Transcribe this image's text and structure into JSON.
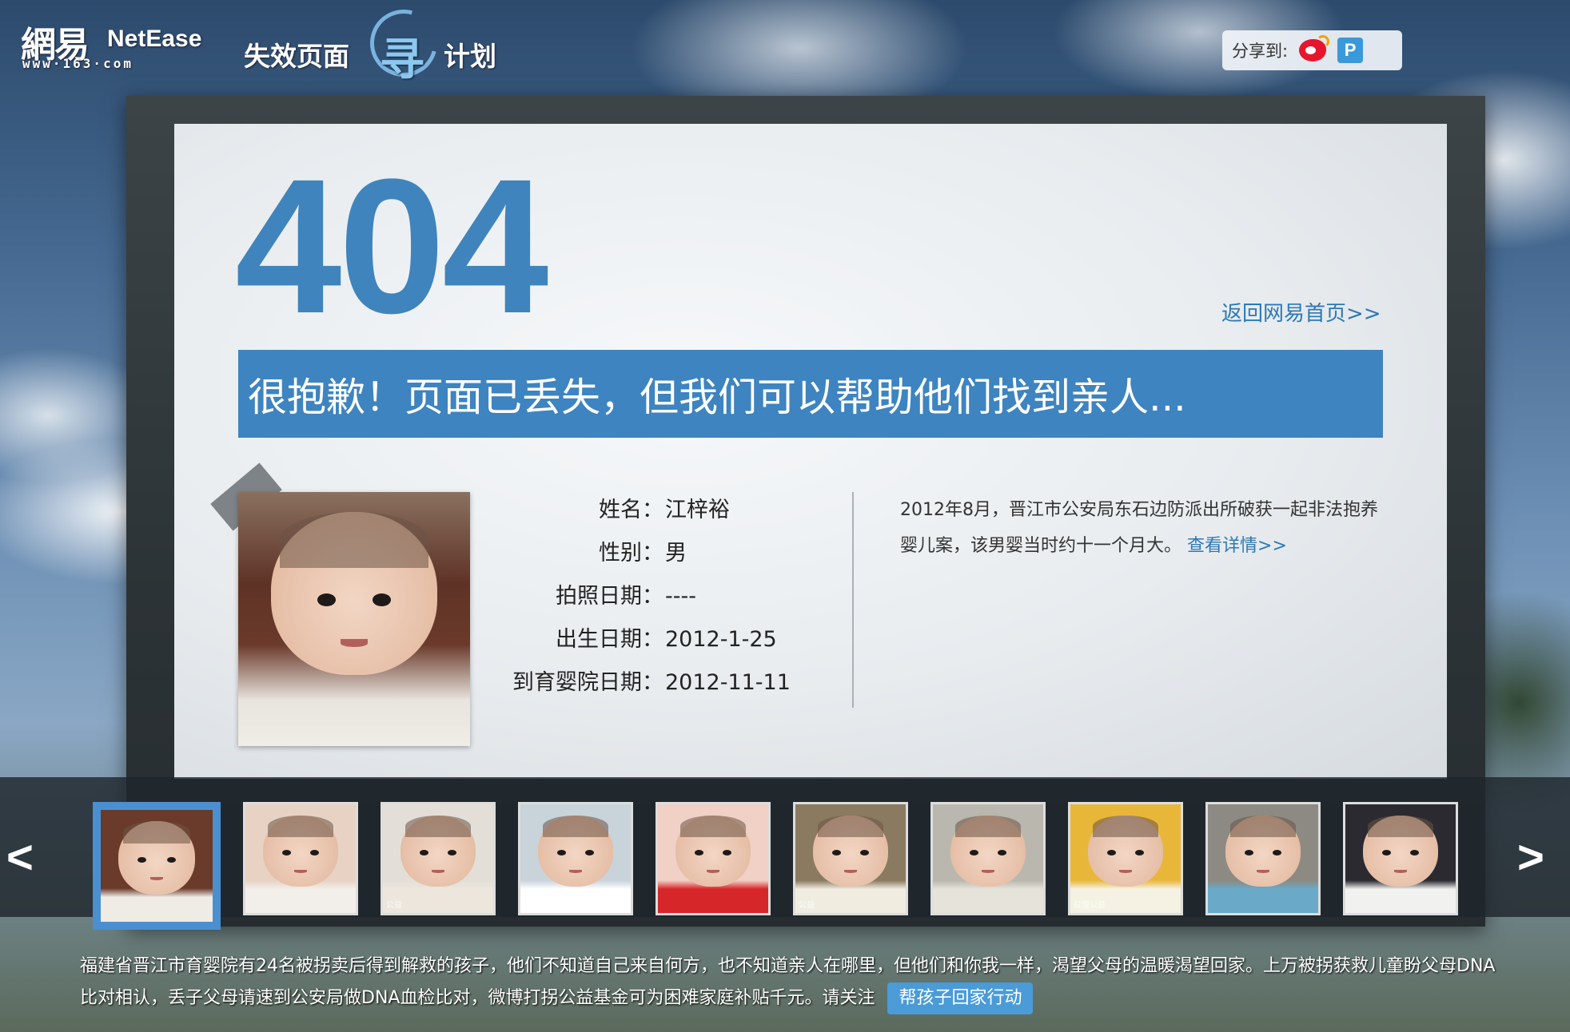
{
  "header": {
    "logo_cn": "網易",
    "logo_en": "NetEase",
    "logo_url": "www·163·com",
    "campaign_pre": "失效页面",
    "campaign_mark": "寻",
    "campaign_post": "计划",
    "share_label": "分享到:",
    "share_icons": [
      "weibo-icon",
      "qq-weibo-icon"
    ]
  },
  "error": {
    "code": "404",
    "home_link": "返回网易首页>>",
    "banner": "很抱歉！页面已丢失，但我们可以帮助他们找到亲人..."
  },
  "child": {
    "fields": [
      {
        "label": "姓名：",
        "value": "江梓裕"
      },
      {
        "label": "性别：",
        "value": "男"
      },
      {
        "label": "拍照日期：",
        "value": "----"
      },
      {
        "label": "出生日期：",
        "value": "2012-1-25"
      },
      {
        "label": "到育婴院日期：",
        "value": "2012-11-11"
      }
    ],
    "story": "2012年8月，晋江市公安局东石边防派出所破获一起非法抱养婴儿案，该男婴当时约十一个月大。",
    "details_link": "查看详情>>"
  },
  "carousel": {
    "prev": "<",
    "next": ">",
    "thumbs": [
      {
        "stamp": "",
        "bg": "#6a3a2a",
        "shirt": "#efebe5"
      },
      {
        "stamp": "",
        "bg": "#e7d2c4",
        "shirt": "#f2eeea"
      },
      {
        "stamp": "公益",
        "bg": "#e3dfd8",
        "shirt": "#ece6dc"
      },
      {
        "stamp": "",
        "bg": "#c9d3da",
        "shirt": "#ffffff"
      },
      {
        "stamp": "",
        "bg": "#f1d0c6",
        "shirt": "#d7262a"
      },
      {
        "stamp": "公益",
        "bg": "#8a7a60",
        "shirt": "#f0ece0"
      },
      {
        "stamp": "",
        "bg": "#b9b7ae",
        "shirt": "#e6e3da"
      },
      {
        "stamp": "益盟公益",
        "bg": "#e8b73a",
        "shirt": "#f5f1e3"
      },
      {
        "stamp": "",
        "bg": "#8c8a82",
        "shirt": "#6aaac8"
      },
      {
        "stamp": "",
        "bg": "#2a2a30",
        "shirt": "#f1f1ef"
      }
    ]
  },
  "footer": {
    "text": "福建省晋江市育婴院有24名被拐卖后得到解救的孩子，他们不知道自己来自何方，也不知道亲人在哪里，但他们和你我一样，渴望父母的温暖渴望回家。上万被拐获救儿童盼父母DNA比对相认，丢子父母请速到公安局做DNA血检比对，微博打拐公益基金可为困难家庭补贴千元。请关注",
    "cta": "帮孩子回家行动"
  }
}
